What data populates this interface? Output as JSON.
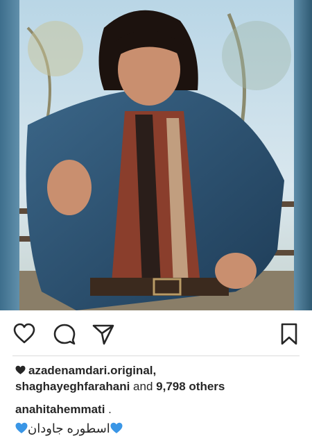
{
  "post": {
    "photo_icon": "vintage-portrait-photo",
    "actions": {
      "like_icon": "heart-outline-icon",
      "comment_icon": "comment-bubble-icon",
      "share_icon": "paper-plane-icon",
      "save_icon": "bookmark-icon"
    },
    "likes": {
      "first": "azadenamdari.original,",
      "second": "shaghayeghfarahani",
      "connector": " and ",
      "others": "9,798 others"
    },
    "caption": {
      "username": "anahitahemmati",
      "text": " ."
    },
    "caption_line": "اسطوره جاودان",
    "colors": {
      "emoji_heart": "#3a96e6",
      "text": "#262626",
      "divider": "#dbdbdb"
    }
  }
}
